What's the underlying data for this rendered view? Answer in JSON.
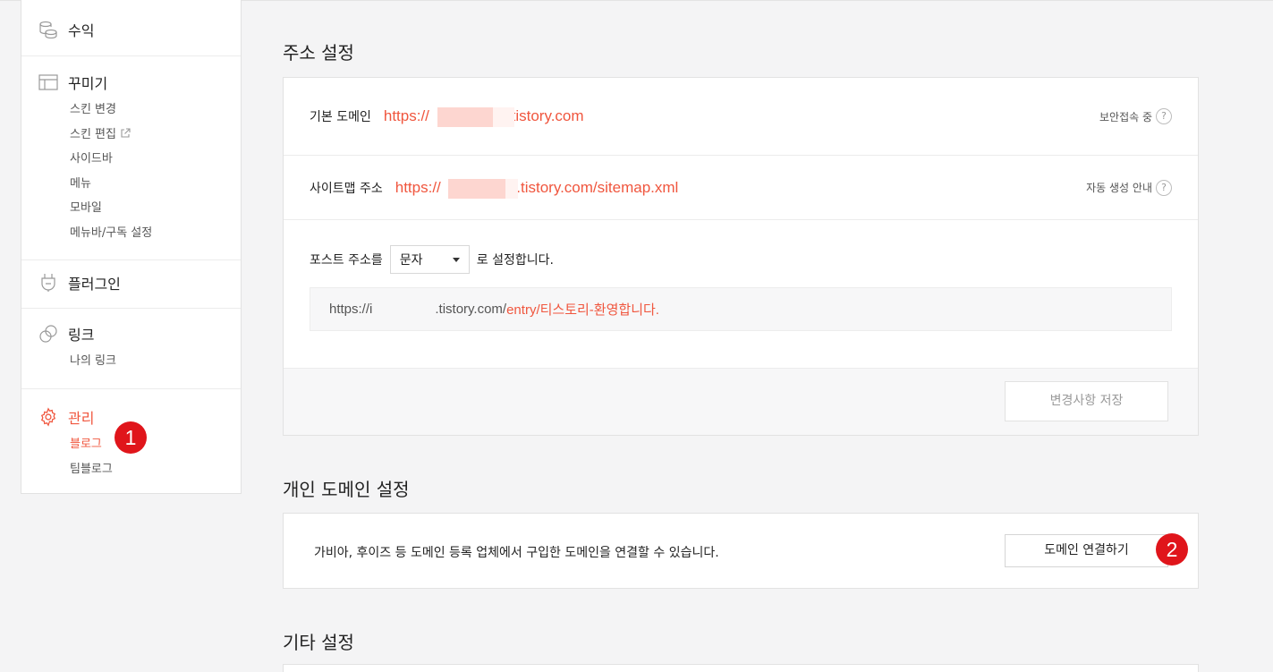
{
  "sidebar": {
    "groups": [
      {
        "label": "수익",
        "icon": "coins-icon",
        "items": []
      },
      {
        "label": "꾸미기",
        "icon": "layout-icon",
        "items": [
          "스킨 변경",
          "스킨 편집",
          "사이드바",
          "메뉴",
          "모바일",
          "메뉴바/구독 설정"
        ]
      },
      {
        "label": "플러그인",
        "icon": "plug-icon",
        "items": []
      },
      {
        "label": "링크",
        "icon": "link-icon",
        "items": [
          "나의 링크"
        ]
      },
      {
        "label": "관리",
        "icon": "gear-icon",
        "items": [
          "블로그",
          "팀블로그"
        ]
      }
    ],
    "active_group": "관리",
    "active_item": "블로그"
  },
  "annotations": {
    "badge1": "1",
    "badge2": "2"
  },
  "address": {
    "title": "주소 설정",
    "base_domain_label": "기본 도메인",
    "base_domain_prefix": "https://",
    "base_domain_suffix": ".tistory.com",
    "secure_label": "보안접속 중",
    "sitemap_label": "사이트맵 주소",
    "sitemap_prefix": "https://",
    "sitemap_suffix": "s.tistory.com/sitemap.xml",
    "autogen_label": "자동 생성 안내",
    "help_mark": "?",
    "post_addr_label": "포스트 주소를",
    "post_addr_select": "문자",
    "post_addr_suffix": "로 설정합니다.",
    "preview_prefix": "https://i",
    "preview_mid": ".tistory.com/",
    "preview_highlight": "entry/티스토리-환영합니다.",
    "save_button": "변경사항 저장"
  },
  "custom_domain": {
    "title": "개인 도메인 설정",
    "description": "가비아, 후이즈 등 도메인 등록 업체에서 구입한 도메인을 연결할 수 있습니다.",
    "connect_button": "도메인 연결하기"
  },
  "etc": {
    "title": "기타 설정"
  },
  "colors": {
    "accent": "#f0563e",
    "badge": "#e0151b",
    "background": "#f4f4f5"
  }
}
